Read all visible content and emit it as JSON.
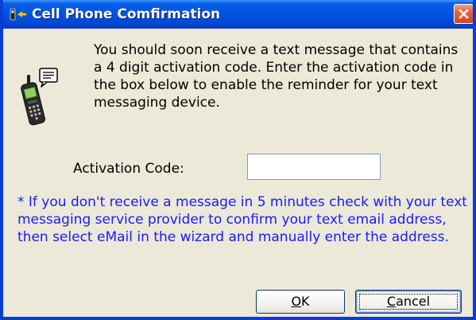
{
  "window": {
    "title": "Cell Phone Comfirmation"
  },
  "icons": {
    "title_icon": "phone-with-arrow-icon",
    "close_icon": "close-icon",
    "dialog_icon": "cell-phone-message-icon"
  },
  "message": "You should soon receive a text message that contains a 4 digit activation code.  Enter the activation code in the box below to enable the reminder for your text messaging device.",
  "activation": {
    "label": "Activation Code:",
    "value": ""
  },
  "note": "* If you don't receive a message in 5 minutes check with your text messaging service provider to confirm your text email address, then select eMail in the wizard and manually enter the address.",
  "buttons": {
    "ok_mnemonic": "O",
    "ok_rest": "K",
    "cancel_mnemonic": "C",
    "cancel_rest": "ancel"
  },
  "colors": {
    "titlebar": "#0054e3",
    "note_text": "#1a1aff",
    "dialog_bg": "#ece9d8",
    "close_button": "#e2623b"
  }
}
